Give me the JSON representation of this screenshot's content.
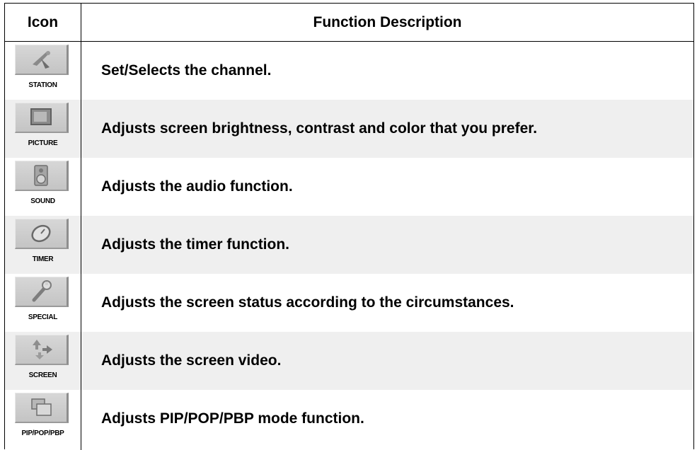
{
  "header": {
    "icon_col": "Icon",
    "desc_col": "Function Description"
  },
  "rows": [
    {
      "label": "STATION",
      "icon": "satellite-dish-icon",
      "desc": "Set/Selects the channel."
    },
    {
      "label": "PICTURE",
      "icon": "monitor-icon",
      "desc": "Adjusts screen brightness, contrast and color  that you prefer."
    },
    {
      "label": "SOUND",
      "icon": "speaker-icon",
      "desc": "Adjusts the audio function."
    },
    {
      "label": "TIMER",
      "icon": "timer-icon",
      "desc": "Adjusts the timer function."
    },
    {
      "label": "SPECIAL",
      "icon": "wrench-icon",
      "desc": "Adjusts the screen status according to the circumstances."
    },
    {
      "label": "SCREEN",
      "icon": "screen-arrows-icon",
      "desc": "Adjusts the screen video."
    },
    {
      "label": "PIP/POP/PBP",
      "icon": "pip-windows-icon",
      "desc": "Adjusts PIP/POP/PBP mode function."
    }
  ],
  "colors": {
    "row_shade": "#efefef",
    "icon_bg": "#cccccc",
    "border": "#000000"
  }
}
